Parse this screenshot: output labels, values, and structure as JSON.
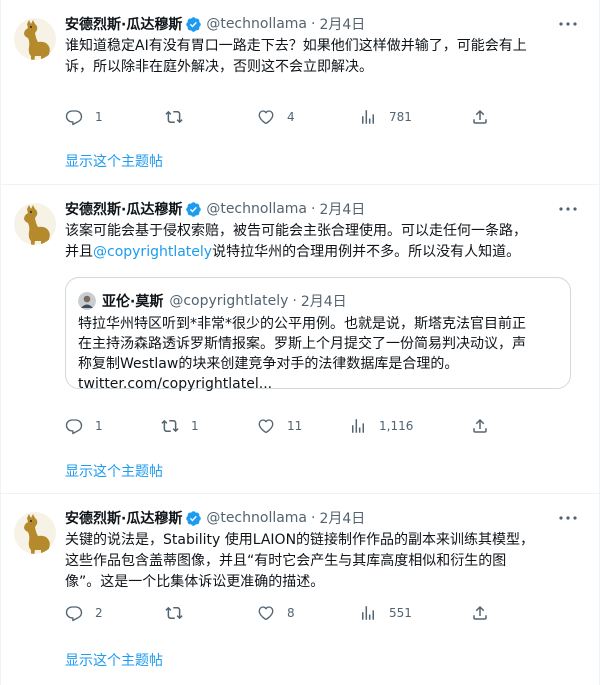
{
  "thread_link_label": "显示这个主题帖",
  "colors": {
    "accent": "#1d9bf0",
    "muted": "#536471",
    "border": "#eff3f4"
  },
  "tweets": [
    {
      "author": {
        "name": "安德烈斯·瓜达穆斯",
        "handle": "@technollama",
        "date": "2月4日",
        "avatar_icon": "llama-avatar-icon",
        "verified": true
      },
      "text": [
        "谁知道稳定AI有没有胃口一路走下去？如果他们这样做并输了，可能会有上",
        "诉，所以除非在庭外解决，否则这不会立即解决。"
      ],
      "stats": {
        "replies": "1",
        "retweets": "",
        "likes": "4",
        "views": "781"
      }
    },
    {
      "author": {
        "name": "安德烈斯·瓜达穆斯",
        "handle": "@technollama",
        "date": "2月4日",
        "avatar_icon": "llama-avatar-icon",
        "verified": true
      },
      "text_line1": "该案可能会基于侵权索赔，被告可能会主张合理使用。可以走任何一条路，",
      "text_line2_prefix": "并且",
      "text_mention": "@copyrightlately",
      "text_line2_suffix": "说特拉华州的合理用例并不多。所以没有人知道。",
      "quote": {
        "name": "亚伦·莫斯",
        "handle": "@copyrightlately",
        "date": "2月4日",
        "text": [
          "特拉华州特区听到*非常*很少的公平用例。也就是说，斯塔克法官目前正",
          "在主持汤森路透诉罗斯情报案。罗斯上个月提交了一份简易判决动议，声",
          "称复制Westlaw的块来创建竞争对手的法律数据库是合理的。"
        ],
        "link": "twitter.com/copyrightlatel..."
      },
      "stats": {
        "replies": "1",
        "retweets": "1",
        "likes": "11",
        "views": "1,116"
      }
    },
    {
      "author": {
        "name": "安德烈斯·瓜达穆斯",
        "handle": "@technollama",
        "date": "2月4日",
        "avatar_icon": "llama-avatar-icon",
        "verified": true
      },
      "text": [
        "关键的说法是，Stability 使用LAION的链接制作作品的副本来训练其模型，",
        "这些作品包含盖蒂图像，并且“有时它会产生与其库高度相似和衍生的图",
        "像”。这是一个比集体诉讼更准确的描述。"
      ],
      "stats": {
        "replies": "2",
        "retweets": "",
        "likes": "8",
        "views": "551"
      }
    }
  ]
}
